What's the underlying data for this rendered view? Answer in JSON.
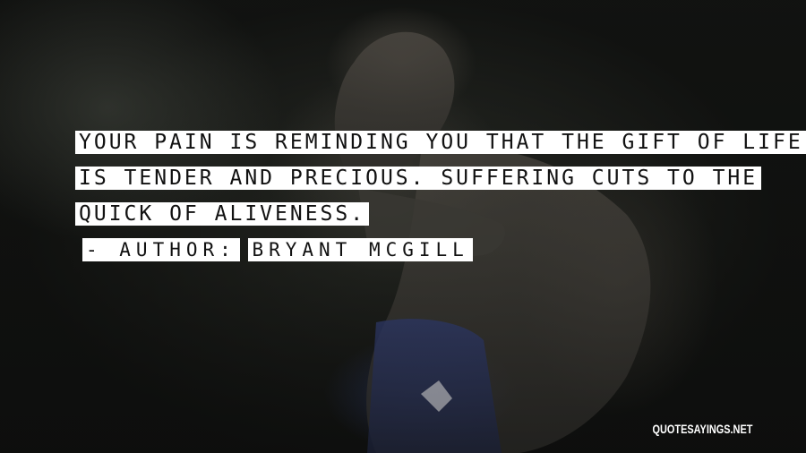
{
  "quote": {
    "lines": [
      "Your pain is reminding you that the gift of life",
      "is tender and precious. Suffering cuts to the",
      "quick of aliveness."
    ],
    "author_prefix": "- Author:",
    "author_name": "Bryant McGill"
  },
  "watermark": "QUOTESAYINGS.NET"
}
